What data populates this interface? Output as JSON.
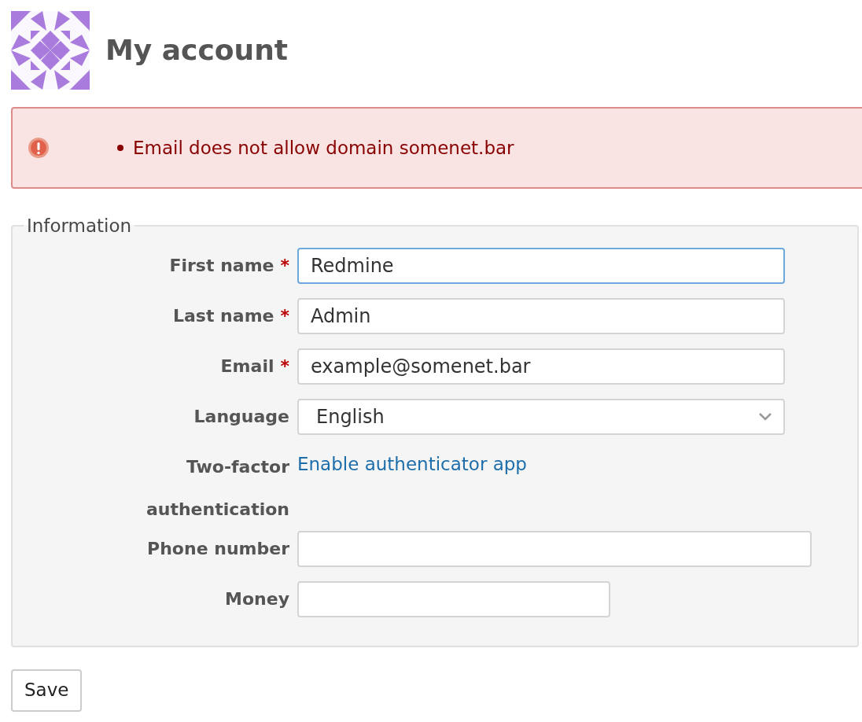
{
  "page": {
    "title": "My account"
  },
  "error": {
    "messages": [
      "Email does not allow domain somenet.bar"
    ]
  },
  "fieldset": {
    "legend": "Information",
    "fields": [
      {
        "kind": "text",
        "label": "First name",
        "required_mark": "*",
        "value": "Redmine",
        "focused": true
      },
      {
        "kind": "text",
        "label": "Last name",
        "required_mark": "*",
        "value": "Admin",
        "focused": false
      },
      {
        "kind": "text",
        "label": "Email",
        "required_mark": "*",
        "value": "example@somenet.bar",
        "focused": false
      },
      {
        "kind": "select",
        "label": "Language",
        "value": "English",
        "focused": false
      },
      {
        "kind": "link",
        "label": "Two-factor authentication",
        "value": "Enable authenticator app"
      },
      {
        "kind": "text",
        "label": "Phone number",
        "focused": false
      },
      {
        "kind": "text",
        "label": "Money",
        "focused": false
      }
    ]
  },
  "buttons": [
    {
      "label": "Save"
    }
  ]
}
